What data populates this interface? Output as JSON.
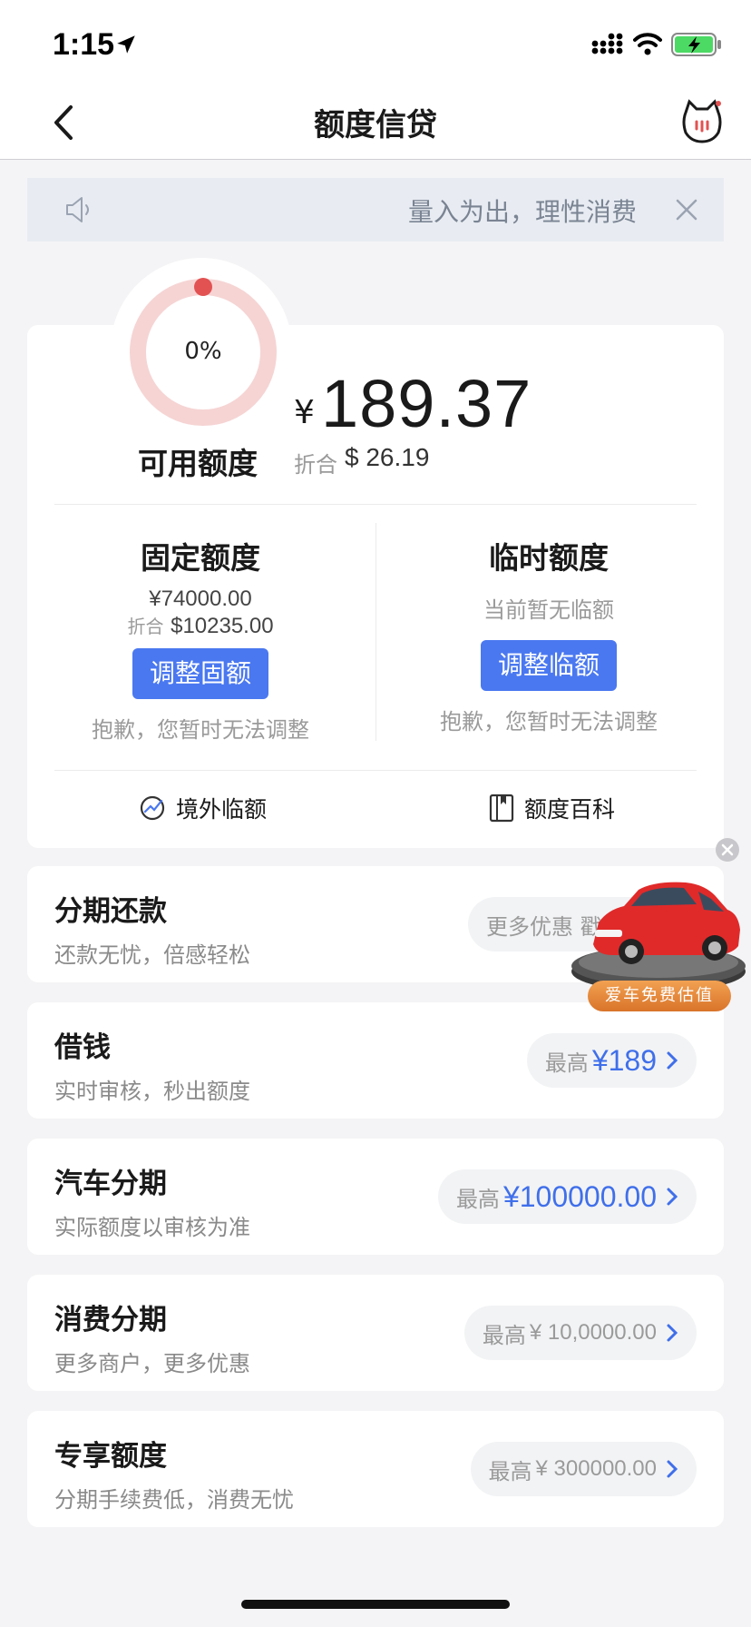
{
  "status_bar": {
    "time": "1:15"
  },
  "nav": {
    "title": "额度信贷"
  },
  "notice": {
    "text": "量入为出，理性消费"
  },
  "credit": {
    "usage_percent_label": "0%",
    "usage_fraction": 0,
    "available_label": "可用额度",
    "currency_symbol": "¥",
    "available_amount": "189.37",
    "conversion_label": "折合",
    "conversion_value": "$ 26.19"
  },
  "fixed": {
    "title": "固定额度",
    "amount": "¥74000.00",
    "conversion_label": "折合",
    "conversion_value": "$10235.00",
    "button": "调整固额",
    "note": "抱歉，您暂时无法调整"
  },
  "temp": {
    "title": "临时额度",
    "status": "当前暂无临额",
    "button": "调整临额",
    "note": "抱歉，您暂时无法调整"
  },
  "links": {
    "overseas": "境外临额",
    "wiki": "额度百科"
  },
  "services": [
    {
      "title": "分期还款",
      "subtitle": "还款无忧，倍感轻松",
      "pill_text": "更多优惠 戳我"
    },
    {
      "title": "借钱",
      "subtitle": "实时审核，秒出额度",
      "pill_prefix": "最高",
      "pill_amount": "¥189"
    },
    {
      "title": "汽车分期",
      "subtitle": "实际额度以审核为准",
      "pill_prefix": "最高",
      "pill_amount": "¥100000.00"
    },
    {
      "title": "消费分期",
      "subtitle": "更多商户，更多优惠",
      "pill_prefix": "最高",
      "pill_amount": "¥ 10,0000.00"
    },
    {
      "title": "专享额度",
      "subtitle": "分期手续费低，消费无忧",
      "pill_prefix": "最高",
      "pill_amount": "¥ 300000.00"
    }
  ],
  "ad": {
    "label": "爱车免费估值"
  },
  "colors": {
    "accent": "#4a78f0",
    "link_blue": "#3f6fea",
    "gauge_track": "#f6d4d4",
    "gauge_dot": "#e25252"
  },
  "icons": [
    "location-arrow-icon",
    "signal-icon",
    "wifi-icon",
    "battery-charging-icon",
    "back-icon",
    "robot-icon",
    "speaker-icon",
    "close-icon",
    "overseas-icon",
    "book-icon",
    "chevron-right-icon"
  ]
}
